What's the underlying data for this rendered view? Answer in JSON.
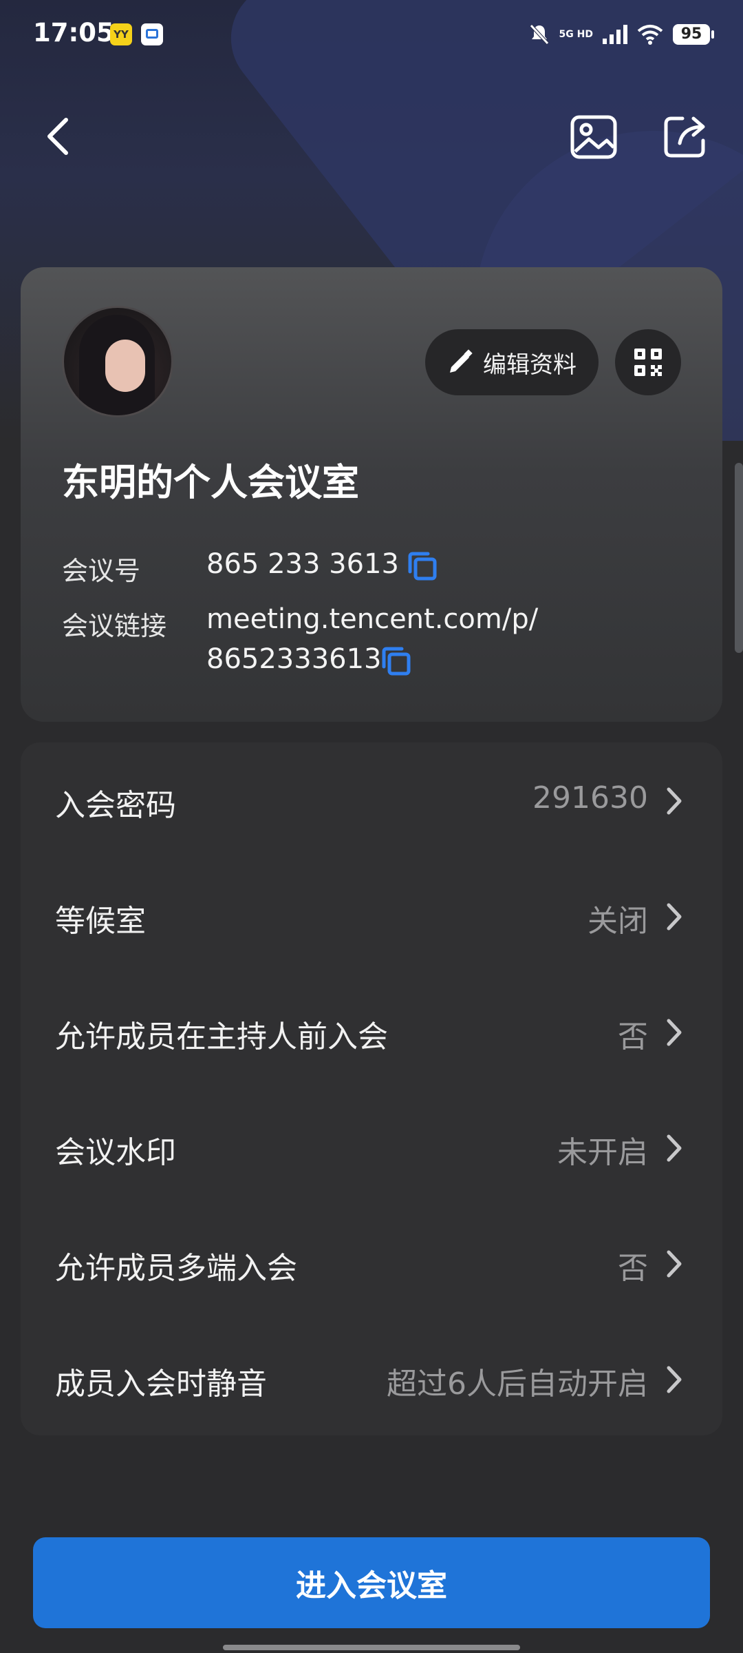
{
  "status_bar": {
    "time": "17:05",
    "network": "5G HD",
    "battery": "95",
    "icons": [
      "yy-app-icon",
      "calendar-app-icon",
      "mute-icon",
      "signal-icon",
      "wifi-icon",
      "battery-icon"
    ]
  },
  "nav": {
    "back_icon": "back-chevron-icon",
    "image_icon": "image-icon",
    "share_icon": "share-icon"
  },
  "profile": {
    "title": "东明的个人会议室",
    "edit_label": "编辑资料",
    "meeting_id_label": "会议号",
    "meeting_id": "865 233 3613",
    "meeting_link_label": "会议链接",
    "meeting_link_line1": "meeting.tencent.com/p/",
    "meeting_link_line2": "8652333613"
  },
  "settings": {
    "items": [
      {
        "label": "入会密码",
        "value": "291630"
      },
      {
        "label": "等候室",
        "value": "关闭"
      },
      {
        "label": "允许成员在主持人前入会",
        "value": "否"
      },
      {
        "label": "会议水印",
        "value": "未开启"
      },
      {
        "label": "允许成员多端入会",
        "value": "否"
      },
      {
        "label": "成员入会时静音",
        "value": "超过6人后自动开启"
      }
    ]
  },
  "actions": {
    "enter_room": "进入会议室"
  },
  "colors": {
    "accent": "#1f74d8",
    "copy_icon": "#2f7ff0",
    "background": "#2b2b2d",
    "card": "#303032"
  }
}
